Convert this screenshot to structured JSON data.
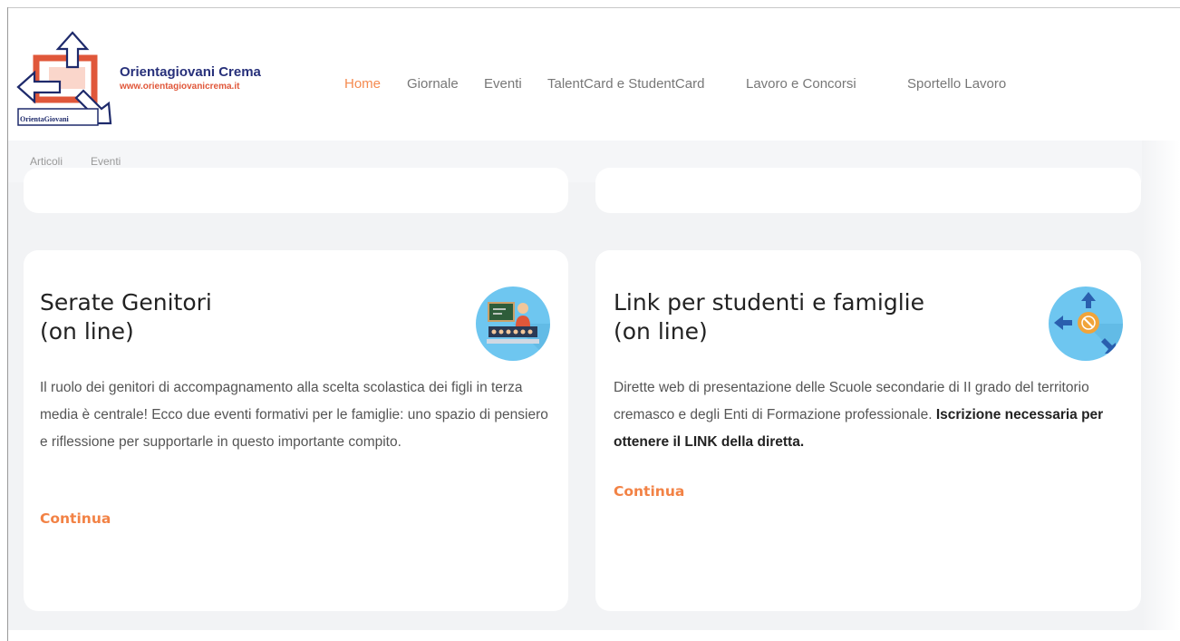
{
  "colors": {
    "accent": "#f28245",
    "nav_active": "#f58a4f",
    "brand_blue": "#27307a",
    "brand_red": "#e0573a",
    "icon_circle": "#6ec6f0",
    "content_bg": "#f2f3f5"
  },
  "logo": {
    "title": "Orientagiovani Crema",
    "url": "www.orientagiovanicrema.it",
    "brand": "OrientaGiovani",
    "icon": "arrows-logo-icon"
  },
  "nav": {
    "items": [
      {
        "label": "Home",
        "active": true
      },
      {
        "label": "Giornale",
        "active": false
      },
      {
        "label": "Eventi",
        "active": false
      },
      {
        "label": "TalentCard e StudentCard",
        "active": false
      },
      {
        "label": "Lavoro e Concorsi",
        "active": false
      },
      {
        "label": "Sportello Lavoro",
        "active": false
      }
    ]
  },
  "subnav": {
    "items": [
      {
        "label": "Articoli"
      },
      {
        "label": "Eventi"
      }
    ]
  },
  "cards": [
    {
      "title_line1": "Serate Genitori",
      "title_line2": "(on line)",
      "icon": "teacher-presentation-icon",
      "body": "Il ruolo dei genitori di accompagnamento alla scelta scolastica dei figli in terza media è centrale! Ecco due eventi formativi per le famiglie: uno spazio di pensiero e riflessione per supportarle in questo importante compito.",
      "link": "Continua"
    },
    {
      "title_line1": "Link per studenti e famiglie",
      "title_line2": "(on line)",
      "icon": "compass-arrows-icon",
      "body": "Dirette web di presentazione delle Scuole secondarie di II grado del territorio cremasco e degli Enti di Formazione professionale.",
      "body_bold": "Iscrizione necessaria per ottenere il LINK della diretta.",
      "link": "Continua"
    }
  ]
}
